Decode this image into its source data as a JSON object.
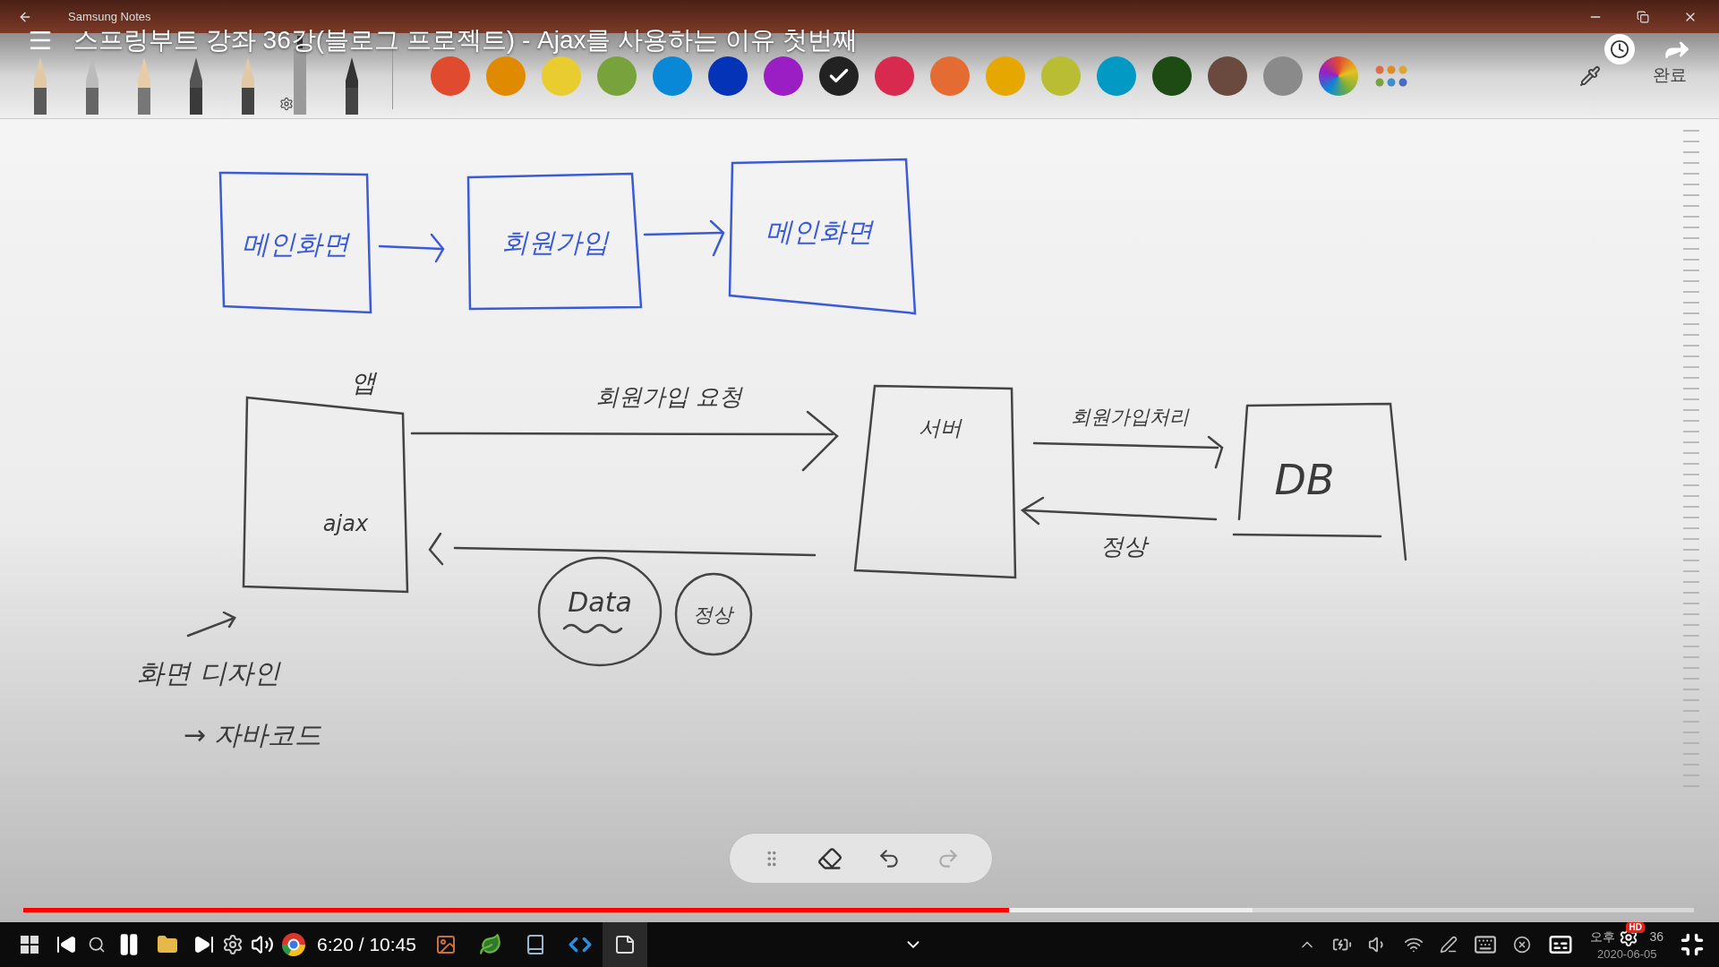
{
  "window": {
    "app_name": "Samsung Notes"
  },
  "video": {
    "title": "스프링부트 강좌 36강(블로그 프로젝트) - Ajax를 사용하는 이유 첫번째",
    "time": "6:20 / 10:45",
    "progress": {
      "level": 0.59
    },
    "buffered": {
      "level": 0.736
    },
    "quality_badge": "HD"
  },
  "toolbar": {
    "pens": [
      {
        "kind": "brush",
        "selected": false
      },
      {
        "kind": "flat",
        "selected": false
      },
      {
        "kind": "pencil",
        "selected": false
      },
      {
        "kind": "fountain",
        "selected": false
      },
      {
        "kind": "calligraphy",
        "selected": false
      },
      {
        "kind": "marker",
        "selected": true
      },
      {
        "kind": "highlighter",
        "selected": false
      }
    ],
    "colors": [
      {
        "kind": "swatch",
        "color": "#e04a2f",
        "selected": false
      },
      {
        "kind": "swatch",
        "color": "#e08a00",
        "selected": false
      },
      {
        "kind": "swatch",
        "color": "#e8cc30",
        "selected": false
      },
      {
        "kind": "swatch",
        "color": "#78a33c",
        "selected": false
      },
      {
        "kind": "swatch",
        "color": "#0a88d8",
        "selected": false
      },
      {
        "kind": "swatch",
        "color": "#0433b8",
        "selected": false
      },
      {
        "kind": "swatch",
        "color": "#9a1ec4",
        "selected": false
      },
      {
        "kind": "swatch",
        "color": "#222222",
        "selected": true
      },
      {
        "kind": "swatch",
        "color": "#d8294f",
        "selected": false
      },
      {
        "kind": "swatch",
        "color": "#e46c32",
        "selected": false
      },
      {
        "kind": "swatch",
        "color": "#e6a800",
        "selected": false
      },
      {
        "kind": "swatch",
        "color": "#b8bd33",
        "selected": false
      },
      {
        "kind": "swatch",
        "color": "#0299c4",
        "selected": false
      },
      {
        "kind": "swatch",
        "color": "#1e4a14",
        "selected": false
      },
      {
        "kind": "swatch",
        "color": "#6a4a3e",
        "selected": false
      },
      {
        "kind": "swatch",
        "color": "#8a8a8a",
        "selected": false
      },
      {
        "kind": "spectrum",
        "selected": false
      }
    ],
    "done": "완료"
  },
  "note": {
    "labels": [
      {
        "text": "메인화면",
        "color": "#3b5bd6"
      },
      {
        "text": "회원가입",
        "color": "#3b5bd6"
      },
      {
        "text": "메인화면",
        "color": "#3b5bd6"
      },
      {
        "text": "앱",
        "color": "#3a3a3a"
      },
      {
        "text": "ajax",
        "color": "#3a3a3a"
      },
      {
        "text": "회원가입 요청",
        "color": "#3a3a3a"
      },
      {
        "text": "서버",
        "color": "#3a3a3a"
      },
      {
        "text": "회원가입처리",
        "color": "#3a3a3a"
      },
      {
        "text": "DB",
        "color": "#3a3a3a"
      },
      {
        "text": "정상",
        "color": "#3a3a3a"
      },
      {
        "text": "Data",
        "color": "#3a3a3a"
      },
      {
        "text": "정상",
        "color": "#3a3a3a"
      },
      {
        "text": "화면 디자인",
        "color": "#3a3a3a"
      },
      {
        "text": "→ 자바코드",
        "color": "#3a3a3a"
      }
    ]
  },
  "floating_toolbar": {
    "undo_disabled": false,
    "redo_disabled": true
  },
  "taskbar": {
    "clock_prefix": "오후",
    "clock_suffix": "36",
    "date": "2020-06-05"
  }
}
